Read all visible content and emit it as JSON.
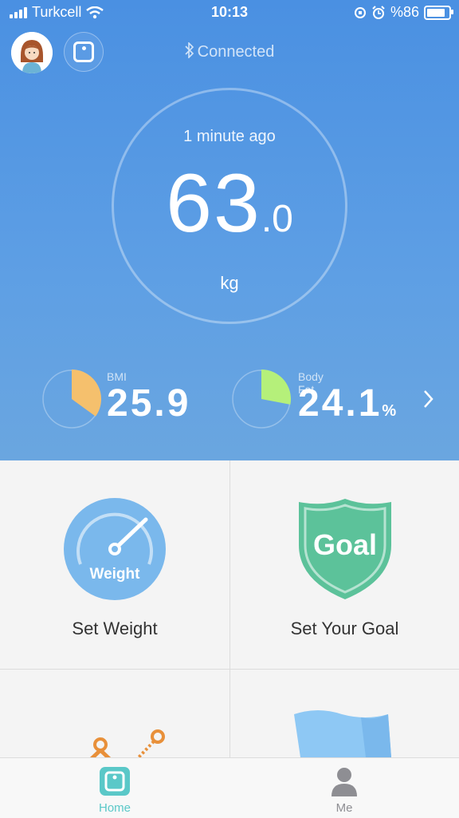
{
  "status_bar": {
    "carrier": "Turkcell",
    "time": "10:13",
    "battery_percent": "%86"
  },
  "header": {
    "connection_status": "Connected"
  },
  "measurement": {
    "time_ago": "1 minute ago",
    "weight_integer": "63",
    "weight_decimal": ".0",
    "unit": "kg"
  },
  "metrics": [
    {
      "label": "BMI",
      "value": "25.9",
      "suffix": "",
      "fraction": 0.35,
      "color": "#f5c06d"
    },
    {
      "label": "Body Fat",
      "value": "24.1",
      "suffix": "%",
      "fraction": 0.28,
      "color": "#b5f07a"
    }
  ],
  "actions": [
    {
      "label": "Set Weight",
      "icon": "weight-gauge-icon",
      "icon_text": "Weight"
    },
    {
      "label": "Set Your Goal",
      "icon": "goal-shield-icon",
      "icon_text": "Goal"
    }
  ],
  "tabs": [
    {
      "label": "Home",
      "active": true,
      "color": "#5ac8c8"
    },
    {
      "label": "Me",
      "active": false,
      "color": "#8e8e93"
    }
  ],
  "colors": {
    "header_blue": "#4a90e2",
    "accent_teal": "#5ac8c8",
    "goal_green": "#5cc29a",
    "weight_blue": "#7ab8ec"
  }
}
